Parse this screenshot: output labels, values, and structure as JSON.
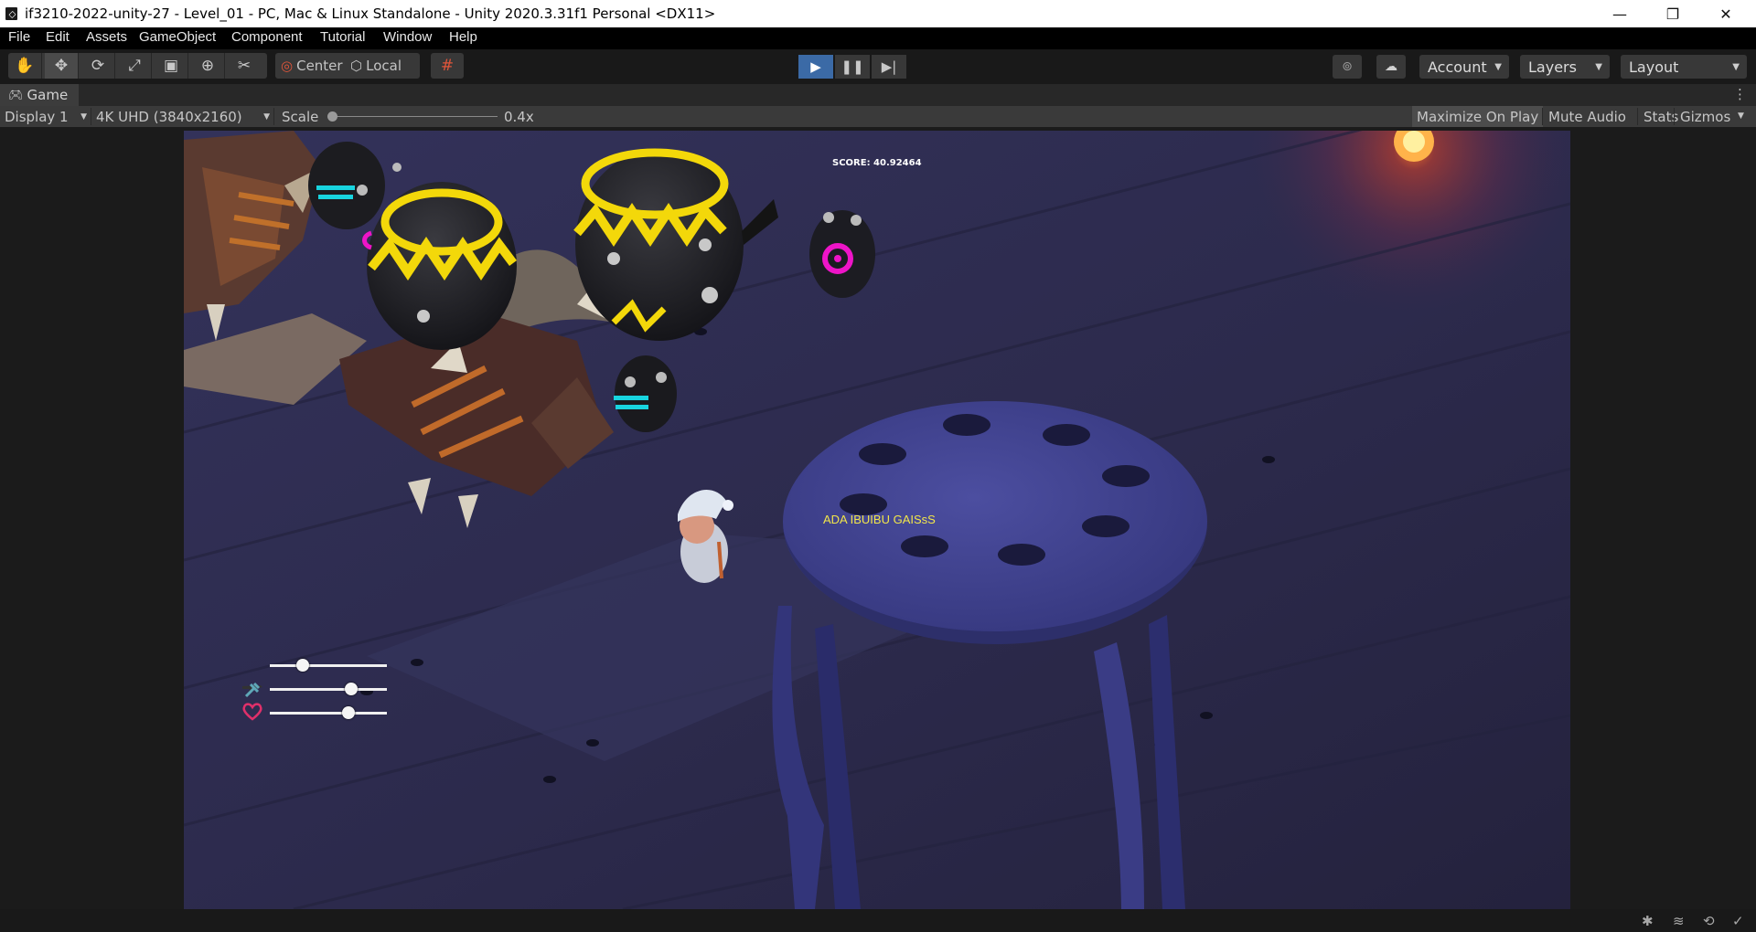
{
  "window": {
    "title": "if3210-2022-unity-27 - Level_01 - PC, Mac & Linux Standalone - Unity 2020.3.31f1 Personal <DX11>",
    "minimize_glyph": "—",
    "maximize_glyph": "❐",
    "close_glyph": "✕"
  },
  "menu": {
    "items": [
      "File",
      "Edit",
      "Assets",
      "GameObject",
      "Component",
      "Tutorial",
      "Window",
      "Help"
    ]
  },
  "toolbar": {
    "tools": [
      "hand-tool-icon",
      "move-tool-icon",
      "rotate-tool-icon",
      "scale-tool-icon",
      "rect-tool-icon",
      "transform-tool-icon",
      "custom-tool-icon"
    ],
    "pivot_label": "Center",
    "space_label": "Local",
    "account_label": "Account",
    "layers_label": "Layers",
    "layout_label": "Layout",
    "play_active": true
  },
  "game_tab": {
    "label": "Game",
    "kebab": "⋮"
  },
  "game_controls": {
    "display": "Display 1",
    "resolution": "4K UHD (3840x2160)",
    "scale_label": "Scale",
    "scale_value": "0.4x",
    "scale_level": 0.0,
    "maximize_on_play": "Maximize On Play",
    "mute_audio": "Mute Audio",
    "stats": "Stats",
    "gizmos": "Gizmos"
  },
  "game_view": {
    "score_text": "SCORE: 40.92464",
    "npc_text": "ADA IBUIBU GAISsS",
    "hud": {
      "sliders": [
        {
          "icon": "gun-icon",
          "level": 0.25,
          "color": "#333333"
        },
        {
          "icon": "speed-icon",
          "level": 0.72,
          "color": "#5fa8b8"
        },
        {
          "icon": "heart-icon",
          "level": 0.69,
          "color": "#e0306a"
        }
      ]
    }
  },
  "colors": {
    "play_accent": "#3b6aa6",
    "npc_text": "#f2e64a",
    "floor": "#2e2c4d"
  }
}
